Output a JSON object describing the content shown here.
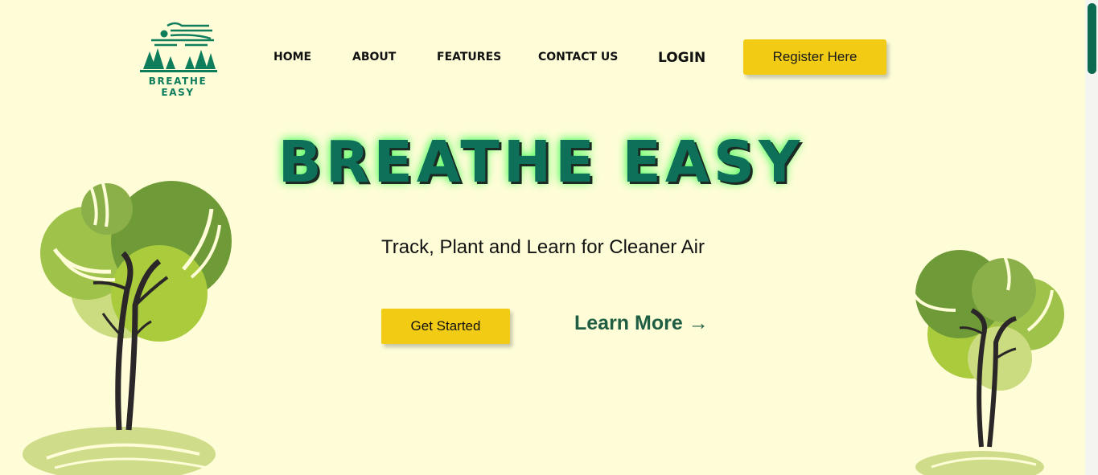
{
  "brand": {
    "name": "BREATHE EASY",
    "logo_icon": "forest-wind-logo"
  },
  "nav": {
    "home": "HOME",
    "about": "ABOUT",
    "features": "FEATURES",
    "contact": "CONTACT US",
    "login": "LOGIN",
    "register": "Register Here"
  },
  "hero": {
    "title": "BREATHE EASY",
    "tagline": "Track, Plant and Learn for Cleaner Air",
    "primary_cta": "Get Started",
    "secondary_cta": "Learn More →"
  },
  "colors": {
    "background": "#fefdd8",
    "brand_green": "#0e7058",
    "button_yellow": "#f2cb14",
    "glow": "#5cff6e"
  },
  "decorations": [
    "tree-left-illustration",
    "tree-right-illustration"
  ]
}
